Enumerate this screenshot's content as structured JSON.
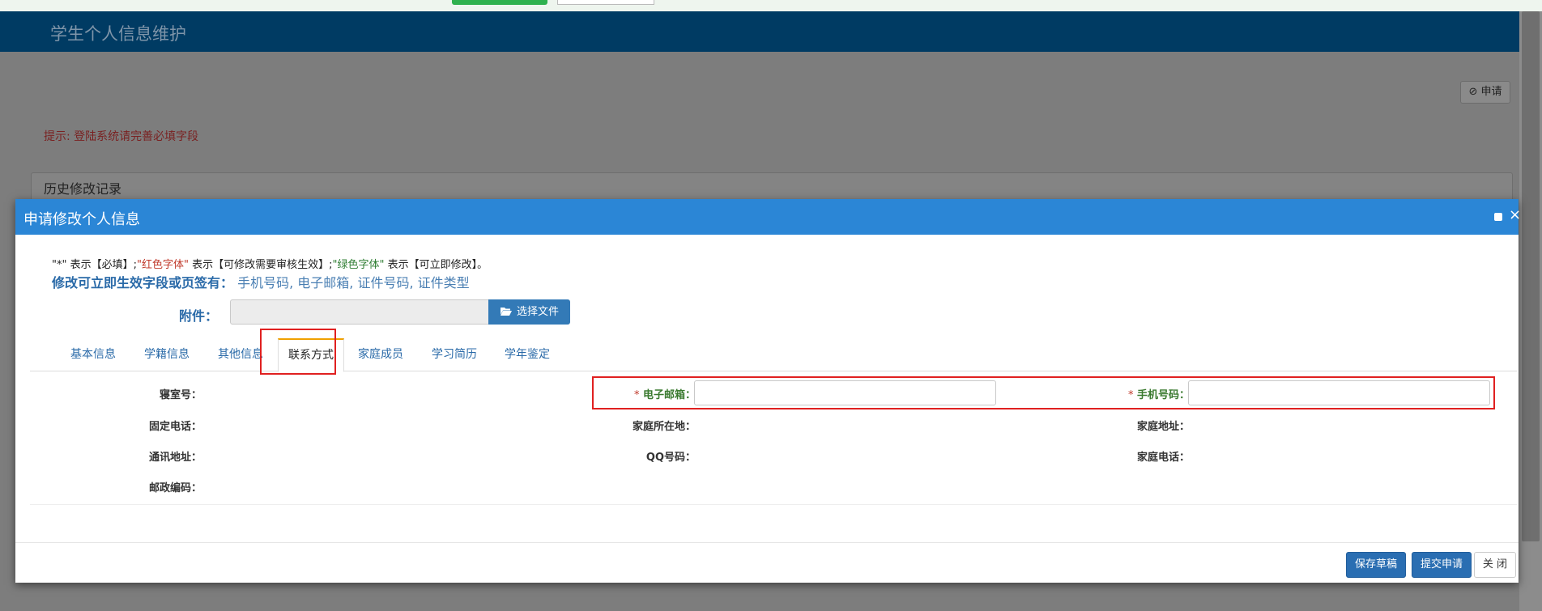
{
  "background": {
    "header_title": "学生个人信息维护",
    "apply_button": "⊘ 申请",
    "hint": "提示: 登陆系统请完善必填字段",
    "history_title": "历史修改记录"
  },
  "modal": {
    "title": "申请修改个人信息",
    "legend": {
      "part1": "\"*\" 表示【必填】;",
      "red": "\"红色字体\"",
      "part2": " 表示【可修改需要审核生效】;",
      "green": "\"绿色字体\"",
      "part3": " 表示【可立即修改】。"
    },
    "quick_label": "修改可立即生效字段或页签有：",
    "quick_value": "手机号码, 电子邮箱, 证件号码, 证件类型",
    "attachment_label": "附件：",
    "choose_file_button": "选择文件",
    "tabs": [
      "基本信息",
      "学籍信息",
      "其他信息",
      "联系方式",
      "家庭成员",
      "学习简历",
      "学年鉴定"
    ],
    "active_tab": "联系方式",
    "fields": {
      "dorm": "寝室号：",
      "email": "电子邮箱：",
      "mobile": "手机号码：",
      "landline": "固定电话：",
      "home_location": "家庭所在地：",
      "home_address": "家庭地址：",
      "mailing_address": "通讯地址：",
      "qq": "QQ号码：",
      "home_phone": "家庭电话：",
      "postcode": "邮政编码："
    },
    "required_star": "*",
    "email_value": "",
    "mobile_value": "",
    "buttons": {
      "save_draft": "保存草稿",
      "submit": "提交申请",
      "close": "关 闭"
    }
  },
  "colors": {
    "header": "#003b63",
    "modal_header": "#2b86d6",
    "primary_button": "#2a6eb2",
    "required_label": "#3a7a2f",
    "highlight_box": "#e02020"
  }
}
